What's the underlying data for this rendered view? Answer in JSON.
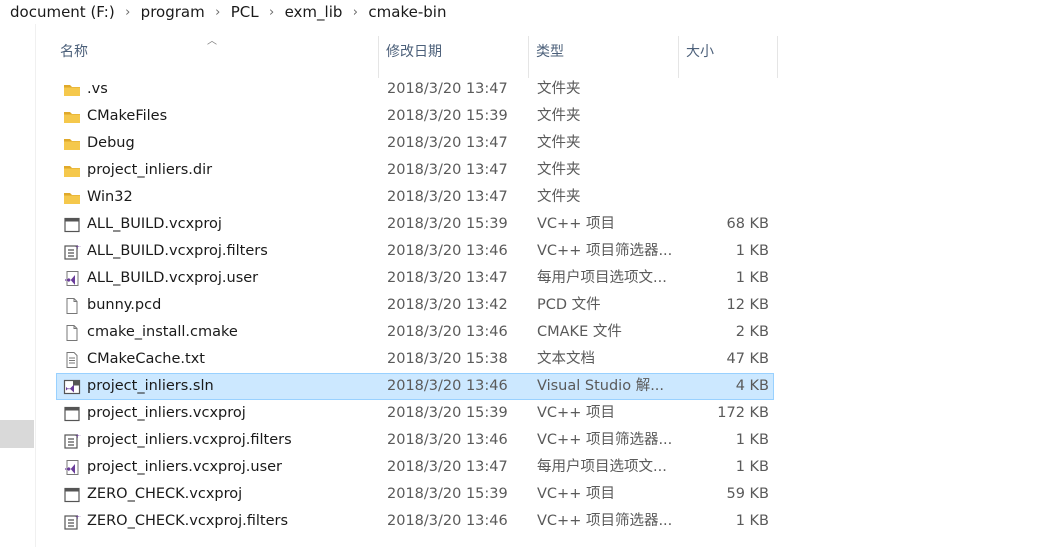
{
  "breadcrumb": [
    "document (F:)",
    "program",
    "PCL",
    "exm_lib",
    "cmake-bin"
  ],
  "columns": {
    "name": "名称",
    "date": "修改日期",
    "type": "类型",
    "size": "大小"
  },
  "colors": {
    "folder": "#f5c84c",
    "selection_bg": "#cce8ff",
    "selection_border": "#99d1ff",
    "vs_purple": "#6a3d9a"
  },
  "files": [
    {
      "name": ".vs",
      "date": "2018/3/20 13:47",
      "type": "文件夹",
      "size": "",
      "icon": "folder-icon"
    },
    {
      "name": "CMakeFiles",
      "date": "2018/3/20 15:39",
      "type": "文件夹",
      "size": "",
      "icon": "folder-icon"
    },
    {
      "name": "Debug",
      "date": "2018/3/20 13:47",
      "type": "文件夹",
      "size": "",
      "icon": "folder-icon"
    },
    {
      "name": "project_inliers.dir",
      "date": "2018/3/20 13:47",
      "type": "文件夹",
      "size": "",
      "icon": "folder-icon"
    },
    {
      "name": "Win32",
      "date": "2018/3/20 13:47",
      "type": "文件夹",
      "size": "",
      "icon": "folder-icon"
    },
    {
      "name": "ALL_BUILD.vcxproj",
      "date": "2018/3/20 15:39",
      "type": "VC++ 项目",
      "size": "68 KB",
      "icon": "vcxproj-icon"
    },
    {
      "name": "ALL_BUILD.vcxproj.filters",
      "date": "2018/3/20 13:46",
      "type": "VC++ 项目筛选器...",
      "size": "1 KB",
      "icon": "vcxproj-filters-icon"
    },
    {
      "name": "ALL_BUILD.vcxproj.user",
      "date": "2018/3/20 13:47",
      "type": "每用户项目选项文...",
      "size": "1 KB",
      "icon": "vs-user-icon"
    },
    {
      "name": "bunny.pcd",
      "date": "2018/3/20 13:42",
      "type": "PCD 文件",
      "size": "12 KB",
      "icon": "blank-file-icon"
    },
    {
      "name": "cmake_install.cmake",
      "date": "2018/3/20 13:46",
      "type": "CMAKE 文件",
      "size": "2 KB",
      "icon": "blank-file-icon"
    },
    {
      "name": "CMakeCache.txt",
      "date": "2018/3/20 15:38",
      "type": "文本文档",
      "size": "47 KB",
      "icon": "text-file-icon"
    },
    {
      "name": "project_inliers.sln",
      "date": "2018/3/20 13:46",
      "type": "Visual Studio 解...",
      "size": "4 KB",
      "icon": "sln-icon",
      "selected": true
    },
    {
      "name": "project_inliers.vcxproj",
      "date": "2018/3/20 15:39",
      "type": "VC++ 项目",
      "size": "172 KB",
      "icon": "vcxproj-icon"
    },
    {
      "name": "project_inliers.vcxproj.filters",
      "date": "2018/3/20 13:46",
      "type": "VC++ 项目筛选器...",
      "size": "1 KB",
      "icon": "vcxproj-filters-icon"
    },
    {
      "name": "project_inliers.vcxproj.user",
      "date": "2018/3/20 13:47",
      "type": "每用户项目选项文...",
      "size": "1 KB",
      "icon": "vs-user-icon"
    },
    {
      "name": "ZERO_CHECK.vcxproj",
      "date": "2018/3/20 15:39",
      "type": "VC++ 项目",
      "size": "59 KB",
      "icon": "vcxproj-icon"
    },
    {
      "name": "ZERO_CHECK.vcxproj.filters",
      "date": "2018/3/20 13:46",
      "type": "VC++ 项目筛选器...",
      "size": "1 KB",
      "icon": "vcxproj-filters-icon"
    }
  ]
}
